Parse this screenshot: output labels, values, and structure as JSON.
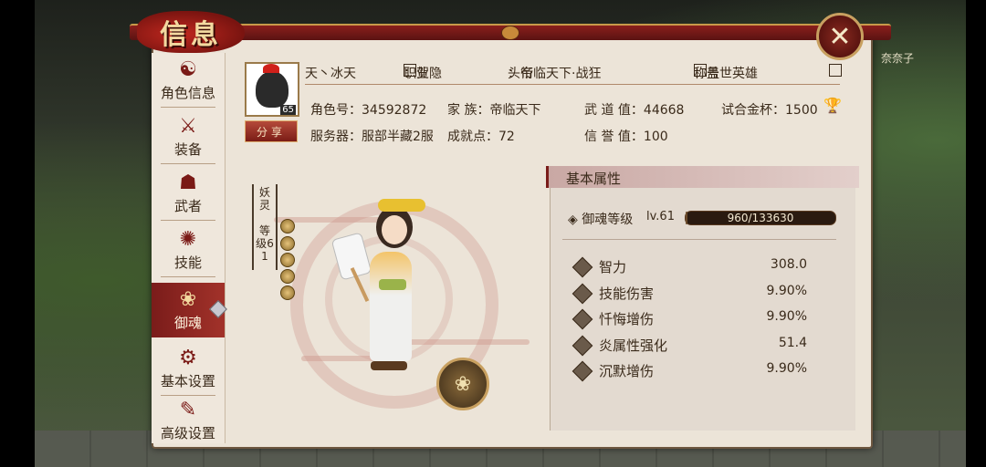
{
  "window": {
    "title": "信息",
    "close_icon": "close-icon"
  },
  "scene": {
    "npc_name": "奈奈子"
  },
  "sidebar": {
    "items": [
      {
        "label": "角色信息",
        "icon": "character-icon",
        "glyph": "☯",
        "active": false
      },
      {
        "label": "装备",
        "icon": "swords-icon",
        "glyph": "⚔",
        "active": false
      },
      {
        "label": "武者",
        "icon": "warrior-icon",
        "glyph": "☗",
        "active": false
      },
      {
        "label": "技能",
        "icon": "skill-icon",
        "glyph": "✺",
        "active": false
      },
      {
        "label": "御魂",
        "icon": "soul-icon",
        "glyph": "❀",
        "active": true
      },
      {
        "label": "基本设置",
        "icon": "gear-icon",
        "glyph": "⚙",
        "active": false
      },
      {
        "label": "高级设置",
        "icon": "advanced-icon",
        "glyph": "✎",
        "active": false
      }
    ]
  },
  "profile": {
    "avatar_level": "65",
    "name": "天丶冰天",
    "job_label": "职业",
    "job": "贺隐",
    "title_label": "头衔",
    "title": "帝临天下·战狂",
    "nickname_label": "称号",
    "nickname": "盖世英雄",
    "share_label": "分享",
    "role_id_label": "角色号",
    "role_id": "34592872",
    "clan_label": "家 族",
    "clan": "帝临天下",
    "martial_label": "武 道 值",
    "martial": "44668",
    "cup_label": "试合金杯",
    "cup": "1500",
    "server_label": "服务器",
    "server": "服部半藏2服",
    "achievement_label": "成就点",
    "achievement": "72",
    "reputation_label": "信 誉 值",
    "reputation": "100"
  },
  "spirit": {
    "type_label": "妖灵",
    "level_label": "等级",
    "level": "61",
    "bead_count": 5
  },
  "attributes": {
    "header": "基本属性",
    "soul_level_label": "御魂等级",
    "soul_level": "lv.61",
    "exp_text": "960/133630",
    "exp_fraction": 0.0072,
    "rows": [
      {
        "name": "智力",
        "value": "308.0"
      },
      {
        "name": "技能伤害",
        "value": "9.90%"
      },
      {
        "name": "忏悔增伤",
        "value": "9.90%"
      },
      {
        "name": "炎属性强化",
        "value": "51.4"
      },
      {
        "name": "沉默增伤",
        "value": "9.90%"
      }
    ]
  },
  "colors": {
    "accent": "#7a1c1a",
    "panel": "#ece4d8",
    "gold": "#c8a060"
  }
}
